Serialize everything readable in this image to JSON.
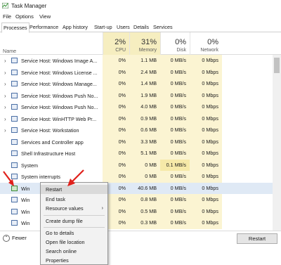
{
  "window": {
    "title": "Task Manager"
  },
  "menu": [
    "File",
    "Options",
    "View"
  ],
  "tabs": [
    "Processes",
    "Performance",
    "App history",
    "Start-up",
    "Users",
    "Details",
    "Services"
  ],
  "header": {
    "name_label": "Name",
    "cpu": {
      "pct": "2%",
      "label": "CPU"
    },
    "memory": {
      "pct": "31%",
      "label": "Memory"
    },
    "disk": {
      "pct": "0%",
      "label": "Disk"
    },
    "network": {
      "pct": "0%",
      "label": "Network"
    }
  },
  "rows": [
    {
      "name": "Service Host: Windows Image A...",
      "cpu": "0%",
      "mem": "1.1 MB",
      "disk": "0 MB/s",
      "net": "0 Mbps"
    },
    {
      "name": "Service Host: Windows License ...",
      "cpu": "0%",
      "mem": "2.4 MB",
      "disk": "0 MB/s",
      "net": "0 Mbps"
    },
    {
      "name": "Service Host: Windows Manage...",
      "cpu": "0%",
      "mem": "1.4 MB",
      "disk": "0 MB/s",
      "net": "0 Mbps"
    },
    {
      "name": "Service Host: Windows Push No...",
      "cpu": "0%",
      "mem": "1.9 MB",
      "disk": "0 MB/s",
      "net": "0 Mbps"
    },
    {
      "name": "Service Host: Windows Push No...",
      "cpu": "0%",
      "mem": "4.0 MB",
      "disk": "0 MB/s",
      "net": "0 Mbps"
    },
    {
      "name": "Service Host: WinHTTP Web Pr...",
      "cpu": "0%",
      "mem": "0.9 MB",
      "disk": "0 MB/s",
      "net": "0 Mbps"
    },
    {
      "name": "Service Host: Workstation",
      "cpu": "0%",
      "mem": "0.6 MB",
      "disk": "0 MB/s",
      "net": "0 Mbps"
    },
    {
      "name": "Services and Controller app",
      "cpu": "0%",
      "mem": "3.3 MB",
      "disk": "0 MB/s",
      "net": "0 Mbps"
    },
    {
      "name": "Shell Infrastructure Host",
      "cpu": "0%",
      "mem": "5.1 MB",
      "disk": "0 MB/s",
      "net": "0 Mbps"
    },
    {
      "name": "System",
      "cpu": "0%",
      "mem": "0 MB",
      "disk": "0.1 MB/s",
      "net": "0 Mbps"
    },
    {
      "name": "System interrupts",
      "cpu": "0%",
      "mem": "0 MB",
      "disk": "0 MB/s",
      "net": "0 Mbps"
    },
    {
      "name": "Win",
      "cpu": "0%",
      "mem": "40.6 MB",
      "disk": "0 MB/s",
      "net": "0 Mbps"
    },
    {
      "name": "Win",
      "cpu": "0%",
      "mem": "0.8 MB",
      "disk": "0 MB/s",
      "net": "0 Mbps"
    },
    {
      "name": "Win",
      "cpu": "0%",
      "mem": "0.5 MB",
      "disk": "0 MB/s",
      "net": "0 Mbps"
    },
    {
      "name": "Win",
      "cpu": "0%",
      "mem": "0.3 MB",
      "disk": "0 MB/s",
      "net": "0 Mbps"
    }
  ],
  "footer": {
    "fewer_details": "Fewer",
    "restart_button": "Restart"
  },
  "context_menu": {
    "restart": "Restart",
    "end_task": "End task",
    "resource_values": "Resource values",
    "create_dump": "Create dump file",
    "go_to_details": "Go to details",
    "open_file_location": "Open file location",
    "search_online": "Search online",
    "properties": "Properties"
  },
  "colors": {
    "accent_arrow": "#e0211b",
    "heat": "#fbf4d2",
    "selected_row": "#dfe9f5"
  }
}
